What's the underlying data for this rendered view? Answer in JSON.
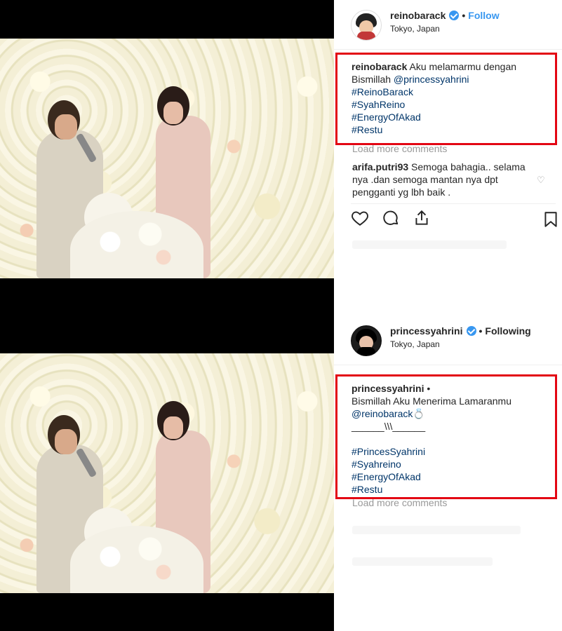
{
  "post1": {
    "username": "reinobarack",
    "follow_label": "Follow",
    "location": "Tokyo, Japan",
    "caption": {
      "username": "reinobarack",
      "text_line1": " Aku melamarmu dengan",
      "text_line2": "Bismillah ",
      "mention": "@princessyahrini",
      "hashtags": [
        "#ReinoBarack",
        "#SyahReino",
        "#EnergyOfAkad",
        "#Restu"
      ]
    },
    "load_more": "Load more comments",
    "comment": {
      "username": "arifa.putri93",
      "text": " Semoga bahagia.. selama nya .dan semoga mantan nya dpt pengganti yg lbh baik ."
    }
  },
  "post2": {
    "username": "princessyahrini",
    "follow_label": "Following",
    "location": "Tokyo, Japan",
    "caption": {
      "username": "princessyahrini",
      "bullet": " •",
      "text_line1": "Bismillah Aku Menerima Lamaranmu",
      "mention": "@reinobarack",
      "ring": "💍",
      "separator": "______\\\\\\______",
      "hashtags": [
        "#PrincesSyahrini",
        "#Syahreino",
        "#EnergyOfAkad",
        "#Restu"
      ]
    },
    "load_more": "Load more comments"
  },
  "colors": {
    "highlight_border": "#e30613",
    "link": "#003569",
    "follow_blue": "#3897f0"
  }
}
